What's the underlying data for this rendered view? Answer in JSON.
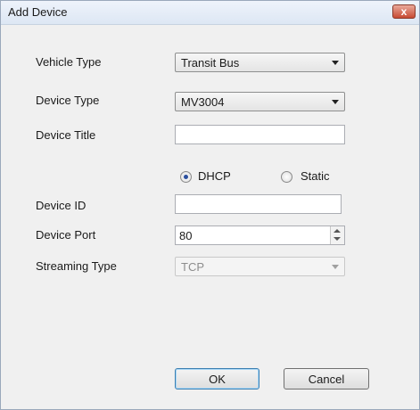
{
  "window": {
    "title": "Add Device",
    "close_label": "x"
  },
  "form": {
    "vehicle_type": {
      "label": "Vehicle Type",
      "value": "Transit Bus"
    },
    "device_type": {
      "label": "Device Type",
      "value": "MV3004"
    },
    "device_title": {
      "label": "Device Title",
      "value": ""
    },
    "addressing": {
      "dhcp_label": "DHCP",
      "static_label": "Static",
      "selected": "DHCP"
    },
    "device_id": {
      "label": "Device ID",
      "value": ""
    },
    "device_port": {
      "label": "Device Port",
      "value": "80"
    },
    "streaming_type": {
      "label": "Streaming Type",
      "value": "TCP"
    }
  },
  "buttons": {
    "ok": "OK",
    "cancel": "Cancel"
  },
  "icons": {
    "close": "close-icon",
    "dropdown": "chevron-down-icon",
    "spin_up": "spin-up-icon",
    "spin_down": "spin-down-icon"
  }
}
